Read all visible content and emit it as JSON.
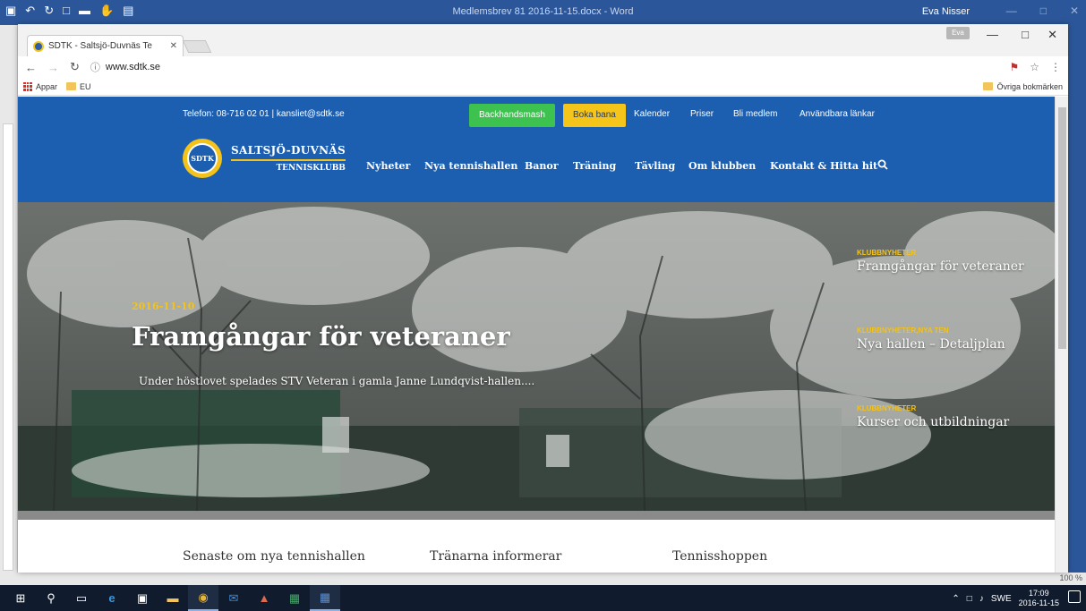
{
  "word": {
    "title": "Medlemsbrev 81 2016-11-15.docx - Word",
    "user": "Eva Nisser",
    "zoom": "100 %"
  },
  "browser": {
    "tab_title": "SDTK - Saltsjö-Duvnäs Te",
    "url": "www.sdtk.se",
    "bookmarks": [
      {
        "label": "Appar"
      },
      {
        "label": "EU"
      }
    ],
    "other_bookmarks": "Övriga bokmärken",
    "guest": "Eva"
  },
  "site": {
    "contact": "Telefon: 08-716 02 01 | kansliet@sdtk.se",
    "top_buttons": [
      {
        "label": "Backhandsmash",
        "bg": "#3ec24f",
        "color": "#ffffff"
      },
      {
        "label": "Boka bana",
        "bg": "#f5c51a",
        "color": "#1c3a6e"
      }
    ],
    "top_links": [
      "Kalender",
      "Priser",
      "Bli medlem",
      "Användbara länkar"
    ],
    "logo": {
      "line1": "SALTSJÖ-DUVNÄS",
      "line2": "TENNISKLUBB",
      "emblem": "SDTK"
    },
    "main_nav": [
      "Nyheter",
      "Nya tennishallen",
      "Banor",
      "Träning",
      "Tävling",
      "Om klubben",
      "Kontakt & Hitta hit"
    ],
    "hero": {
      "date": "2016-11-10",
      "title": "Framgångar för veteraner",
      "excerpt": "Under höstlovet spelades STV Veteran i gamla Janne Lundqvist-hallen...."
    },
    "side_items": [
      {
        "category": "KLUBBNYHETER",
        "title": "Framgångar för veteraner"
      },
      {
        "category": "KLUBBNYHETER,NYA TEN",
        "title": "Nya hallen – Detaljplan"
      },
      {
        "category": "KLUBBNYHETER",
        "title": "Kurser och utbildningar"
      }
    ],
    "sections": [
      "Senaste om nya tennishallen",
      "Tränarna informerar",
      "Tennisshoppen"
    ]
  },
  "taskbar": {
    "lang": "SWE",
    "time": "17:09",
    "date": "2016-11-15"
  },
  "colors": {
    "header_blue": "#1c5eaf",
    "accent_yellow": "#f3c21b",
    "word_blue": "#2b579a"
  }
}
